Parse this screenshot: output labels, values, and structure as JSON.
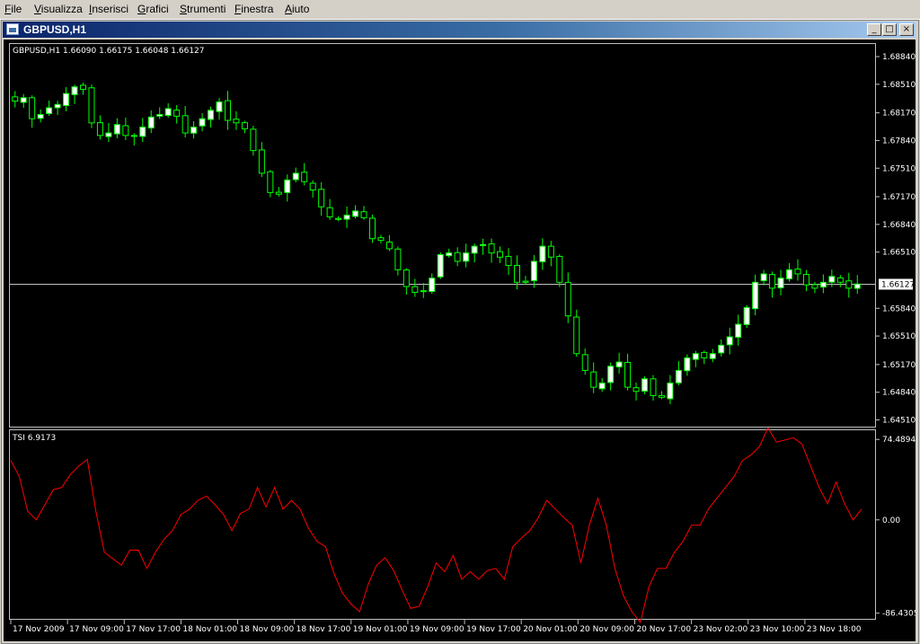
{
  "menu": [
    "File",
    "Visualizza",
    "Inserisci",
    "Grafici",
    "Strumenti",
    "Finestra",
    "Aiuto"
  ],
  "window": {
    "title": "GBPUSD,H1",
    "minimize": "_",
    "restore": "□",
    "close": "×"
  },
  "chart_data": {
    "type": "candlestick",
    "symbol_label": "GBPUSD,H1",
    "ohlc_label": "1.66090 1.66175 1.66048 1.66127",
    "current_price_label": "1.66127",
    "price_ticks": [
      "1.68840",
      "1.68510",
      "1.68170",
      "1.67840",
      "1.67510",
      "1.67170",
      "1.66840",
      "1.66510",
      "1.66127",
      "1.65840",
      "1.65510",
      "1.65170",
      "1.64840",
      "1.64510"
    ],
    "price_range": [
      1.6443,
      1.6899
    ],
    "current_price": 1.66127,
    "candle_close_path": [
      1.6831,
      1.6835,
      1.681,
      1.6815,
      1.6823,
      1.6827,
      1.684,
      1.6848,
      1.6845,
      1.6805,
      1.679,
      1.6793,
      1.6803,
      1.679,
      1.679,
      1.68,
      1.6812,
      1.6815,
      1.6822,
      1.6813,
      1.6793,
      1.68,
      1.681,
      1.682,
      1.683,
      1.6808,
      1.6805,
      1.6798,
      1.6772,
      1.6745,
      1.6722,
      1.672,
      1.6737,
      1.6745,
      1.6735,
      1.6725,
      1.6705,
      1.6693,
      1.669,
      1.6695,
      1.67,
      1.6692,
      1.6667,
      1.6665,
      1.6655,
      1.663,
      1.661,
      1.6603,
      1.6605,
      1.662,
      1.6648,
      1.665,
      1.664,
      1.665,
      1.6658,
      1.666,
      1.665,
      1.6645,
      1.6635,
      1.6615,
      1.6615,
      1.664,
      1.6658,
      1.6645,
      1.6615,
      1.6575,
      1.653,
      1.651,
      1.649,
      1.6495,
      1.6515,
      1.652,
      1.649,
      1.6485,
      1.65,
      1.648,
      1.6478,
      1.6495,
      1.651,
      1.6525,
      1.653,
      1.6525,
      1.653,
      1.654,
      1.655,
      1.6565,
      1.6585,
      1.6615,
      1.6625,
      1.6608,
      1.662,
      1.663,
      1.6625,
      1.6612,
      1.6608,
      1.6615,
      1.6622,
      1.6615,
      1.6608,
      1.6613
    ],
    "indicator": {
      "label": "TSI 6.9173",
      "color": "#ff0000",
      "ticks": [
        "74.4894",
        "0.00",
        "-86.4305"
      ],
      "range": [
        -90,
        78
      ],
      "values": [
        55,
        40,
        8,
        0,
        14,
        28,
        30,
        42,
        50,
        56,
        8,
        -30,
        -36,
        -42,
        -28,
        -28,
        -45,
        -30,
        -18,
        -10,
        5,
        10,
        18,
        22,
        14,
        5,
        -10,
        6,
        10,
        30,
        12,
        30,
        10,
        18,
        10,
        -8,
        -20,
        -25,
        -50,
        -68,
        -78,
        -85,
        -60,
        -42,
        -35,
        -47,
        -65,
        -82,
        -80,
        -62,
        -40,
        -48,
        -33,
        -55,
        -48,
        -55,
        -47,
        -45,
        -55,
        -25,
        -17,
        -10,
        2,
        18,
        10,
        2,
        -5,
        -40,
        -5,
        20,
        -5,
        -45,
        -70,
        -85,
        -95,
        -62,
        -45,
        -45,
        -30,
        -20,
        -5,
        -5,
        10,
        20,
        30,
        40,
        55,
        60,
        68,
        85,
        72,
        74,
        76,
        70,
        50,
        30,
        15,
        35,
        15,
        0,
        10
      ]
    },
    "time_labels": [
      "17 Nov 2009",
      "17 Nov 09:00",
      "17 Nov 17:00",
      "18 Nov 01:00",
      "18 Nov 09:00",
      "18 Nov 17:00",
      "19 Nov 01:00",
      "19 Nov 09:00",
      "19 Nov 17:00",
      "20 Nov 01:00",
      "20 Nov 09:00",
      "20 Nov 17:00",
      "23 Nov 02:00",
      "23 Nov 10:00",
      "23 Nov 18:00"
    ],
    "colors": {
      "bull": "#ffffff",
      "bear": "#000000",
      "wick": "#00ff00",
      "grid": "#c0c0c0",
      "text": "#ffffff",
      "price_line": "#c0c0c0"
    }
  }
}
